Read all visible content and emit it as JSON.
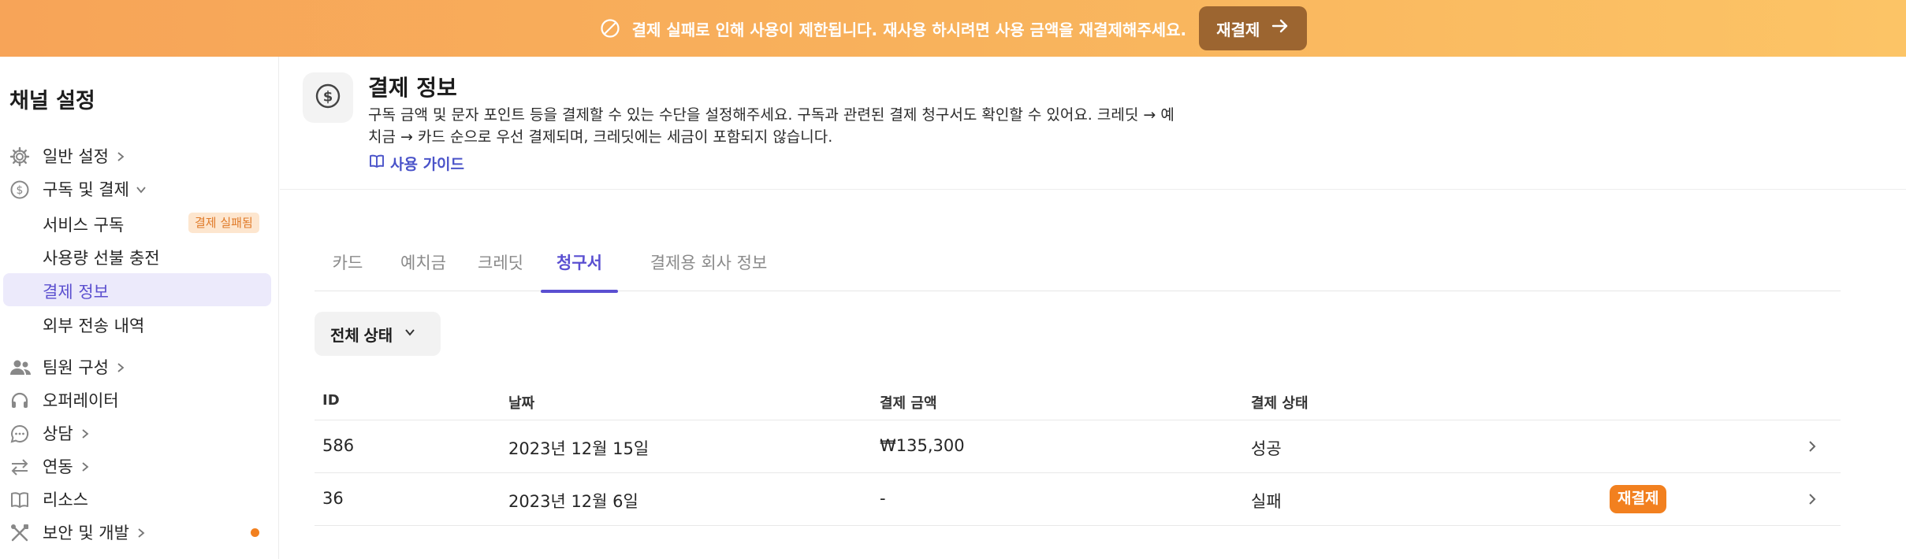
{
  "banner": {
    "icon": "forbidden-icon",
    "message": "결제 실패로 인해 사용이 제한됩니다. 재사용 하시려면 사용 금액을 재결제해주세요.",
    "button_label": "재결제",
    "button_icon": "arrow-right-icon",
    "colors": {
      "start": "#f7a458",
      "end": "#fcc466",
      "button": "#9c6530"
    }
  },
  "sidebar": {
    "title": "채널 설정",
    "items": [
      {
        "label": "일반 설정",
        "icon": "gear-icon",
        "chevron": "right"
      },
      {
        "label": "구독 및 결제",
        "icon": "dollar-circle-icon",
        "chevron": "down",
        "children": [
          {
            "label": "서비스 구독",
            "badge": "결제 실패됨"
          },
          {
            "label": "사용량 선불 충전"
          },
          {
            "label": "결제 정보",
            "active": true
          },
          {
            "label": "외부 전송 내역"
          }
        ]
      },
      {
        "label": "팀원 구성",
        "icon": "people-icon",
        "chevron": "right"
      },
      {
        "label": "오퍼레이터",
        "icon": "headset-icon"
      },
      {
        "label": "상담",
        "icon": "chat-bubble-icon",
        "chevron": "right"
      },
      {
        "label": "연동",
        "icon": "swap-arrows-icon",
        "chevron": "right"
      },
      {
        "label": "리소스",
        "icon": "book-icon"
      },
      {
        "label": "보안 및 개발",
        "icon": "tools-icon",
        "chevron": "right",
        "dot": true
      }
    ]
  },
  "header": {
    "icon": "dollar-circle-icon",
    "title": "결제 정보",
    "description_line1": "구독 금액 및 문자 포인트 등을 결제할 수 있는 수단을 설정해주세요. 구독과 관련된 결제 청구서도 확인할 수 있어요. 크레딧 → 예",
    "description_line2": "치금 → 카드 순으로 우선 결제되며, 크레딧에는 세금이 포함되지 않습니다.",
    "guide_label": "사용 가이드",
    "guide_icon": "book-open-icon"
  },
  "tabs": [
    {
      "label": "카드"
    },
    {
      "label": "예치금"
    },
    {
      "label": "크레딧"
    },
    {
      "label": "청구서",
      "active": true
    },
    {
      "label": "결제용 회사 정보"
    }
  ],
  "filter": {
    "label": "전체 상태",
    "icon": "chevron-down-icon"
  },
  "table": {
    "columns": [
      "ID",
      "날짜",
      "결제 금액",
      "결제 상태"
    ],
    "rows": [
      {
        "id": "586",
        "date": "2023년 12월 15일",
        "amount": "₩135,300",
        "status": "성공"
      },
      {
        "id": "36",
        "date": "2023년 12월 6일",
        "amount": "-",
        "status": "실패",
        "action": "재결제"
      }
    ]
  },
  "colors": {
    "accent": "#5a4fd1",
    "warning": "#f2801f"
  }
}
